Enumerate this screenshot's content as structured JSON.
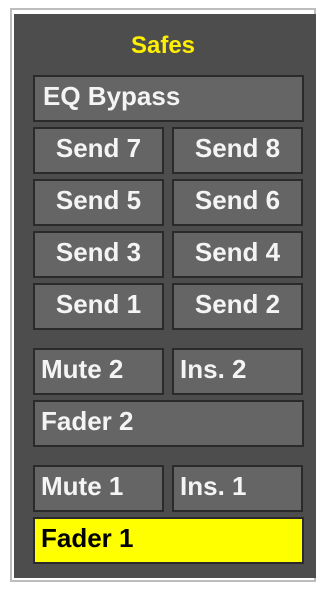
{
  "panel": {
    "title": "Safes",
    "accent_color": "#ffff00"
  },
  "buttons": {
    "eq_bypass": "EQ Bypass",
    "send_7": "Send 7",
    "send_8": "Send 8",
    "send_5": "Send 5",
    "send_6": "Send 6",
    "send_3": "Send 3",
    "send_4": "Send 4",
    "send_1": "Send 1",
    "send_2": "Send 2",
    "mute_2": "Mute 2",
    "ins_2": "Ins. 2",
    "fader_2": "Fader 2",
    "mute_1": "Mute 1",
    "ins_1": "Ins. 1",
    "fader_1": "Fader 1"
  },
  "states": {
    "fader_1_active": true
  }
}
